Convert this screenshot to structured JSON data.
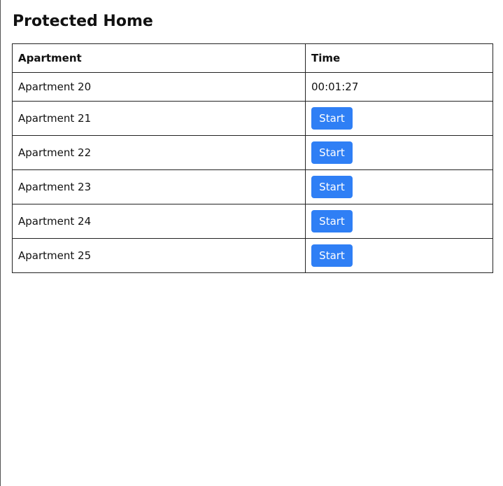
{
  "page": {
    "title": "Protected Home"
  },
  "table": {
    "headers": {
      "apartment": "Apartment",
      "time": "Time"
    },
    "rows": [
      {
        "apartment": "Apartment 20",
        "time": "00:01:27"
      },
      {
        "apartment": "Apartment 21",
        "button": "Start"
      },
      {
        "apartment": "Apartment 22",
        "button": "Start"
      },
      {
        "apartment": "Apartment 23",
        "button": "Start"
      },
      {
        "apartment": "Apartment 24",
        "button": "Start"
      },
      {
        "apartment": "Apartment 25",
        "button": "Start"
      }
    ]
  },
  "colors": {
    "button_background": "#2f7ff5",
    "button_text": "#ffffff",
    "border": "#222222"
  }
}
